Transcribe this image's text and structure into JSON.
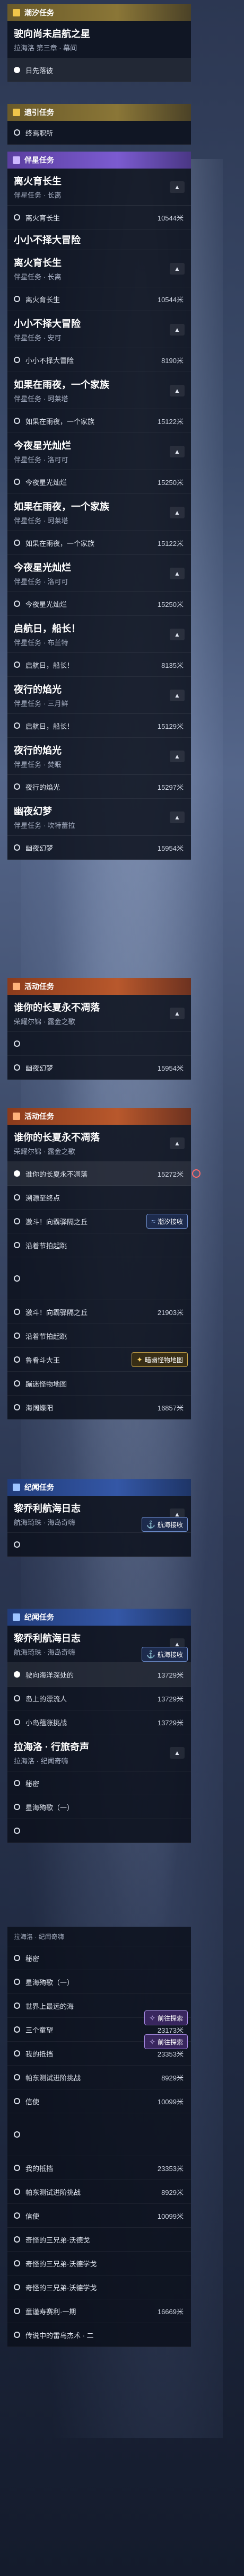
{
  "screen": {
    "group1": {
      "header": "潮汐任务",
      "card": {
        "title": "驶向尚未启航之星",
        "sub": "拉海洛 第三章 · 幕间"
      },
      "rows": [
        {
          "label": "日先落彼",
          "dist": ""
        }
      ]
    },
    "group2": {
      "header": "遗引任务",
      "rows": [
        {
          "label": "终焉职所",
          "dist": ""
        }
      ]
    },
    "group3": {
      "header": "伴星任务",
      "cards": [
        {
          "title": "离火育长生",
          "sub": "伴星任务 · 长离",
          "rows": [
            {
              "label": "离火育长生",
              "dist": "10544米"
            }
          ]
        },
        {
          "title": "小小不择大冒险",
          "sub": "",
          "rows": []
        },
        {
          "title": "离火育长生",
          "sub": "伴星任务 · 长离",
          "rows": [
            {
              "label": "离火育长生",
              "dist": "10544米"
            }
          ]
        },
        {
          "title": "小小不择大冒险",
          "sub": "伴星任务 · 安可",
          "rows": [
            {
              "label": "小小不择大冒险",
              "dist": "8190米"
            }
          ]
        },
        {
          "title": "如果在雨夜，一个家族",
          "sub": "伴星任务 · 珂莱塔",
          "rows": [
            {
              "label": "如果在雨夜，一个家族",
              "dist": "15122米"
            }
          ]
        },
        {
          "title": "今夜星光灿烂",
          "sub": "伴星任务 · 洛可可",
          "rows": [
            {
              "label": "今夜星光灿烂",
              "dist": "15250米"
            }
          ]
        },
        {
          "title": "如果在雨夜，一个家族",
          "sub": "伴星任务 · 珂莱塔",
          "rows": [
            {
              "label": "如果在雨夜，一个家族",
              "dist": "15122米"
            }
          ]
        },
        {
          "title": "今夜星光灿烂",
          "sub": "伴星任务 · 洛可可",
          "rows": [
            {
              "label": "今夜星光灿烂",
              "dist": "15250米"
            }
          ]
        },
        {
          "title": "启航日，船长！",
          "sub": "伴星任务 · 布兰特",
          "rows": [
            {
              "label": "启航日，船长！",
              "dist": "8135米"
            }
          ]
        },
        {
          "title": "夜行的焰光",
          "sub": "伴星任务 · 三月鲜",
          "rows": [
            {
              "label": "启航日，船长！",
              "dist": "15129米"
            }
          ]
        },
        {
          "title": "夜行的焰光",
          "sub": "伴星任务 · 焚眠",
          "rows": [
            {
              "label": "夜行的焰光",
              "dist": "15297米"
            }
          ]
        },
        {
          "title": "幽夜幻梦",
          "sub": "伴星任务 · 坎特蕾拉",
          "rows": [
            {
              "label": "幽夜幻梦",
              "dist": "15954米"
            }
          ]
        }
      ]
    },
    "group4": {
      "header": "活动任务",
      "cards": [
        {
          "title": "谁你的长夏永不凋落",
          "sub": "荣耀尔锦 · 露金之歌",
          "rows": [
            {
              "label": "",
              "dist": ""
            },
            {
              "label": "幽夜幻梦",
              "dist": "15954米"
            }
          ]
        }
      ]
    },
    "group5": {
      "header": "活动任务",
      "cards": [
        {
          "title": "谁你的长夏永不凋落",
          "sub": "荣耀尔锦 · 露金之歌",
          "rows": [
            {
              "label": "谁你的长夏永不凋落",
              "dist": "15272米"
            },
            {
              "label": "溯源至终点",
              "dist": ""
            },
            {
              "label": "激斗！向霸驿隔之丘",
              "dist": ""
            },
            {
              "label": "沿着节拍起跳",
              "dist": ""
            },
            {
              "label": "",
              "dist": ""
            },
            {
              "label": "激斗！向霸驿隔之丘",
              "dist": "21903米"
            },
            {
              "label": "沿着节拍起跳",
              "dist": ""
            },
            {
              "label": "鲁肴斗大王",
              "dist": ""
            },
            {
              "label": "蹦迷怪物地图",
              "dist": ""
            },
            {
              "label": "海阔蝶阳",
              "dist": "16857米"
            }
          ]
        }
      ]
    },
    "group6": {
      "header": "纪闻任务",
      "cards": [
        {
          "title": "黎乔利航海日志",
          "sub": "航海琦珠 · 海岛奇嗨",
          "rows": [
            {
              "label": "",
              "dist": ""
            }
          ]
        }
      ]
    },
    "group7": {
      "header": "纪闻任务",
      "cards": [
        {
          "title": "黎乔利航海日志",
          "sub": "航海琦珠 · 海岛奇嗨",
          "rows": [
            {
              "label": "驶向海洋深处的",
              "dist": "13729米"
            },
            {
              "label": "岛上的漂流人",
              "dist": "13729米"
            },
            {
              "label": "小岛蕴涨挑战",
              "dist": "13729米"
            }
          ]
        },
        {
          "title": "拉海洛 · 行旅奇声",
          "sub": "拉海洛 · 纪闻奇嗨",
          "rows": [
            {
              "label": "秘密",
              "dist": ""
            },
            {
              "label": "星海殉歌（一）",
              "dist": ""
            },
            {
              "label": "",
              "dist": ""
            }
          ]
        }
      ]
    },
    "group8": {
      "sectionTitle": "拉海洛 · 纪闻奇嗨",
      "rows": [
        {
          "label": "秘密",
          "dist": ""
        },
        {
          "label": "星海殉歌（一）",
          "dist": ""
        },
        {
          "label": "世界上最远的海",
          "dist": ""
        },
        {
          "label": "三个童望",
          "dist": "23173米"
        },
        {
          "label": "我的抵挡",
          "dist": "23353米"
        },
        {
          "label": "帕东测试进阶挑战",
          "dist": "8929米"
        },
        {
          "label": "信使",
          "dist": "10099米"
        },
        {
          "label": "",
          "dist": ""
        },
        {
          "label": "我的抵挡",
          "dist": "23353米"
        },
        {
          "label": "帕东测试进阶挑战",
          "dist": "8929米"
        },
        {
          "label": "信使",
          "dist": "10099米"
        },
        {
          "label": "奇怪的三兄弟·沃德戈",
          "dist": ""
        },
        {
          "label": "奇怪的三兄弟·沃德学戈",
          "dist": ""
        },
        {
          "label": "奇怪的三兄弟·沃德学戈",
          "dist": ""
        },
        {
          "label": "童谨寿赛利·一期",
          "dist": "16669米"
        },
        {
          "label": "传说中的雷鸟杰术 · 二",
          "dist": ""
        }
      ]
    },
    "badges": {
      "nav": "前往探索",
      "boss": "暗幽怪物地图",
      "sail": "航海接收",
      "tide": "潮汐接收"
    },
    "colors": {
      "gold": "#8a7637",
      "purple": "#7b5bd0",
      "orange": "#b8582c",
      "blue": "#3457a6"
    }
  }
}
